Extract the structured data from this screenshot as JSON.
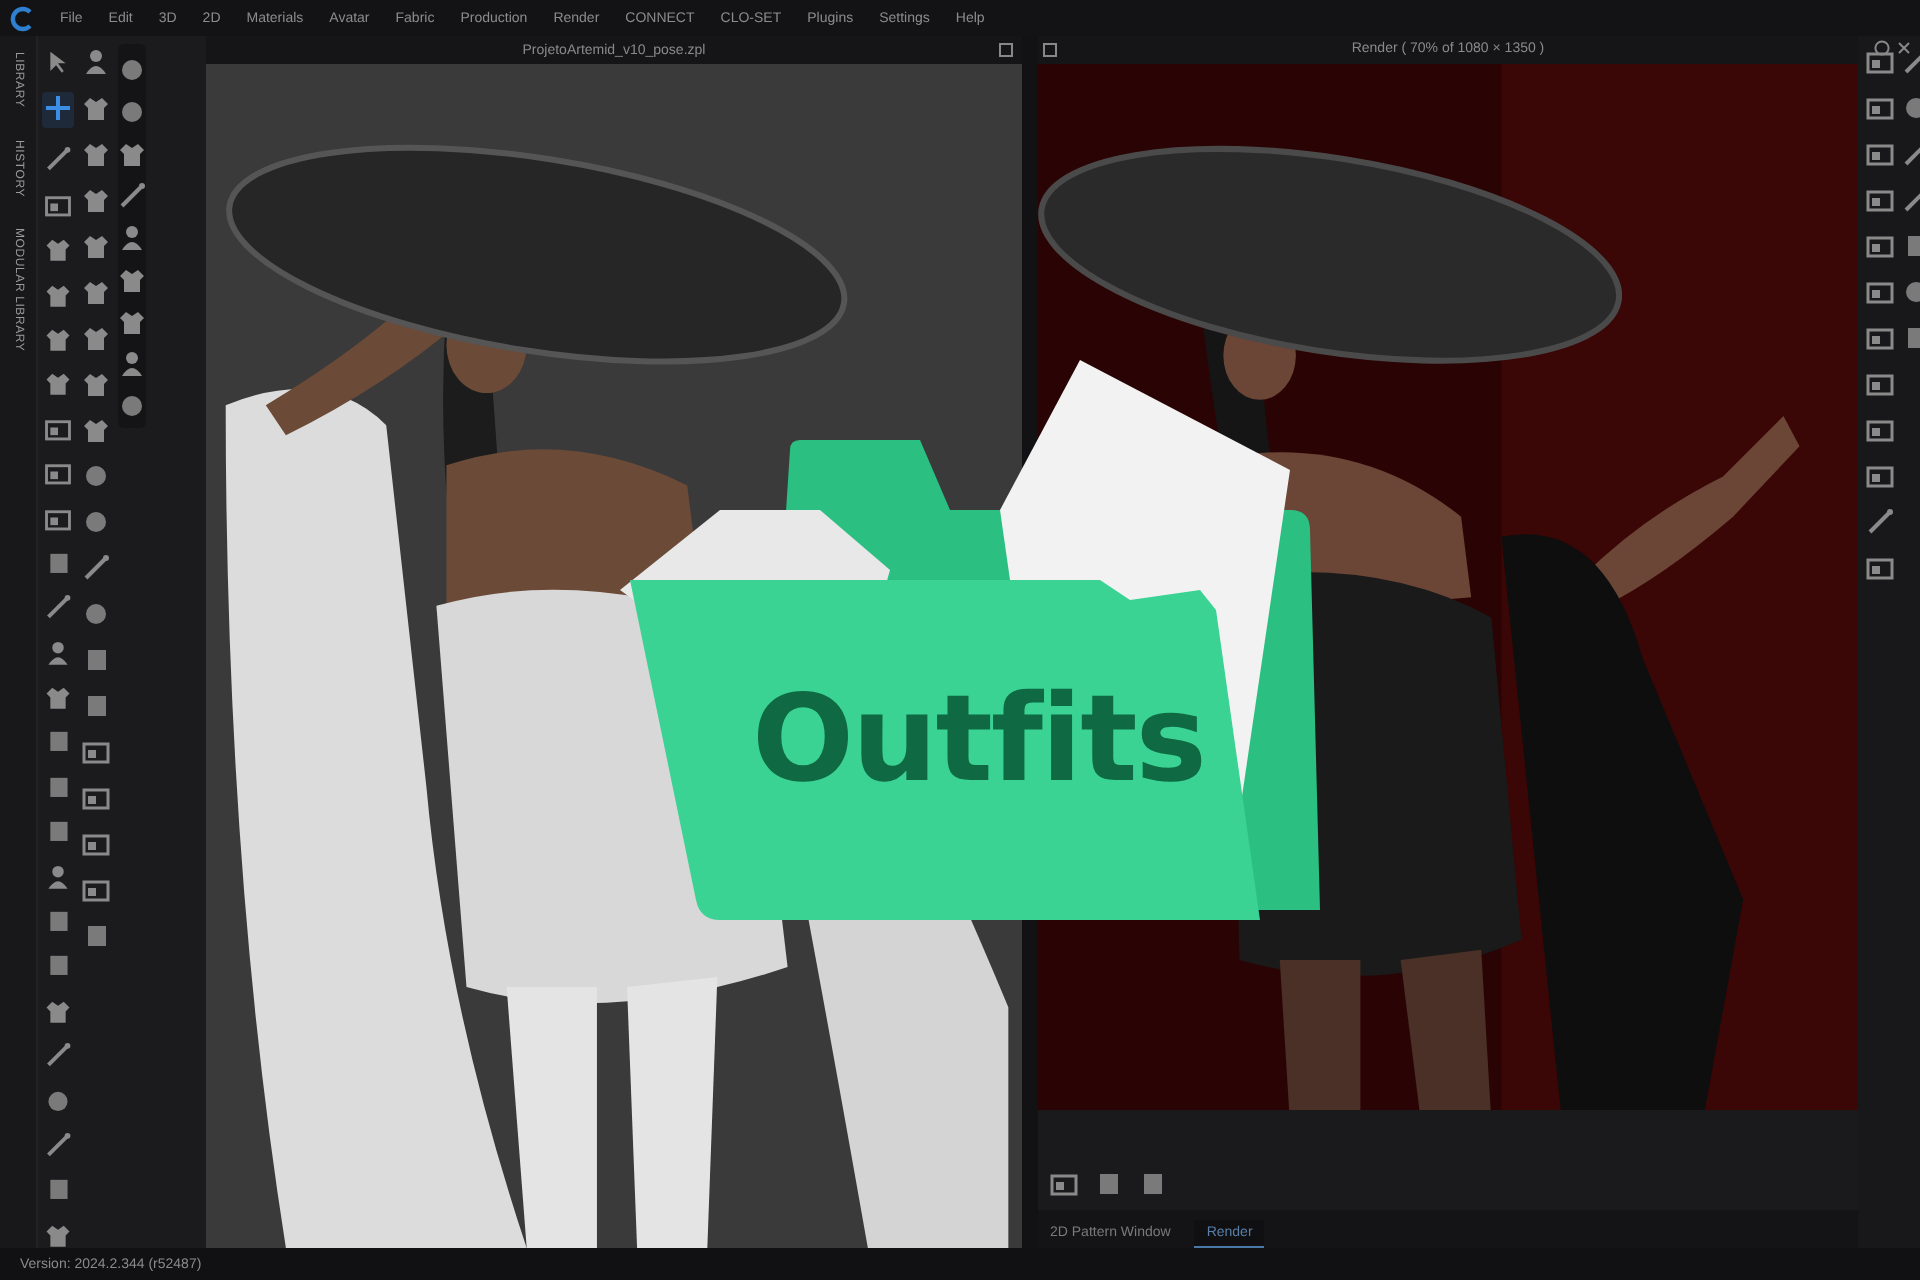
{
  "menu": [
    "File",
    "Edit",
    "3D",
    "2D",
    "Materials",
    "Avatar",
    "Fabric",
    "Production",
    "Render",
    "CONNECT",
    "CLO-SET",
    "Plugins",
    "Settings",
    "Help"
  ],
  "side_tabs": [
    {
      "label": "LIBRARY"
    },
    {
      "label": "HISTORY"
    },
    {
      "label": "MODULAR LIBRARY"
    }
  ],
  "viewport_3d": {
    "title": "ProjetoArtemid_v10_pose.zpl"
  },
  "render_window": {
    "title": "Render ( 70% of 1080 × 1350 )"
  },
  "bottom_tabs": [
    {
      "label": "2D Pattern Window",
      "selected": false
    },
    {
      "label": "Render",
      "selected": true
    }
  ],
  "status_bar": "Version: 2024.2.344 (r52487)",
  "overlay": {
    "label": "Outfits"
  }
}
